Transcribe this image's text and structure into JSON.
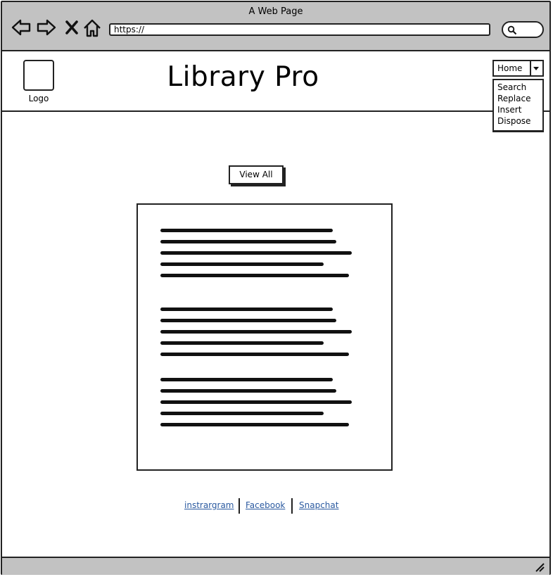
{
  "browser": {
    "window_title": "A Web Page",
    "url": "https://",
    "icons": [
      "back-arrow-icon",
      "forward-arrow-icon",
      "close-x-icon",
      "home-icon",
      "search-icon"
    ]
  },
  "header": {
    "logo_label": "Logo",
    "title": "Library Pro",
    "dropdown": {
      "selected": "Home",
      "options": [
        "Search",
        "Replace",
        "Insert",
        "Dispose"
      ]
    }
  },
  "main": {
    "view_all_label": "View All",
    "text_block_paragraphs": 3
  },
  "footer": {
    "links": [
      "instrargram",
      "Facebook",
      "Snapchat"
    ]
  }
}
